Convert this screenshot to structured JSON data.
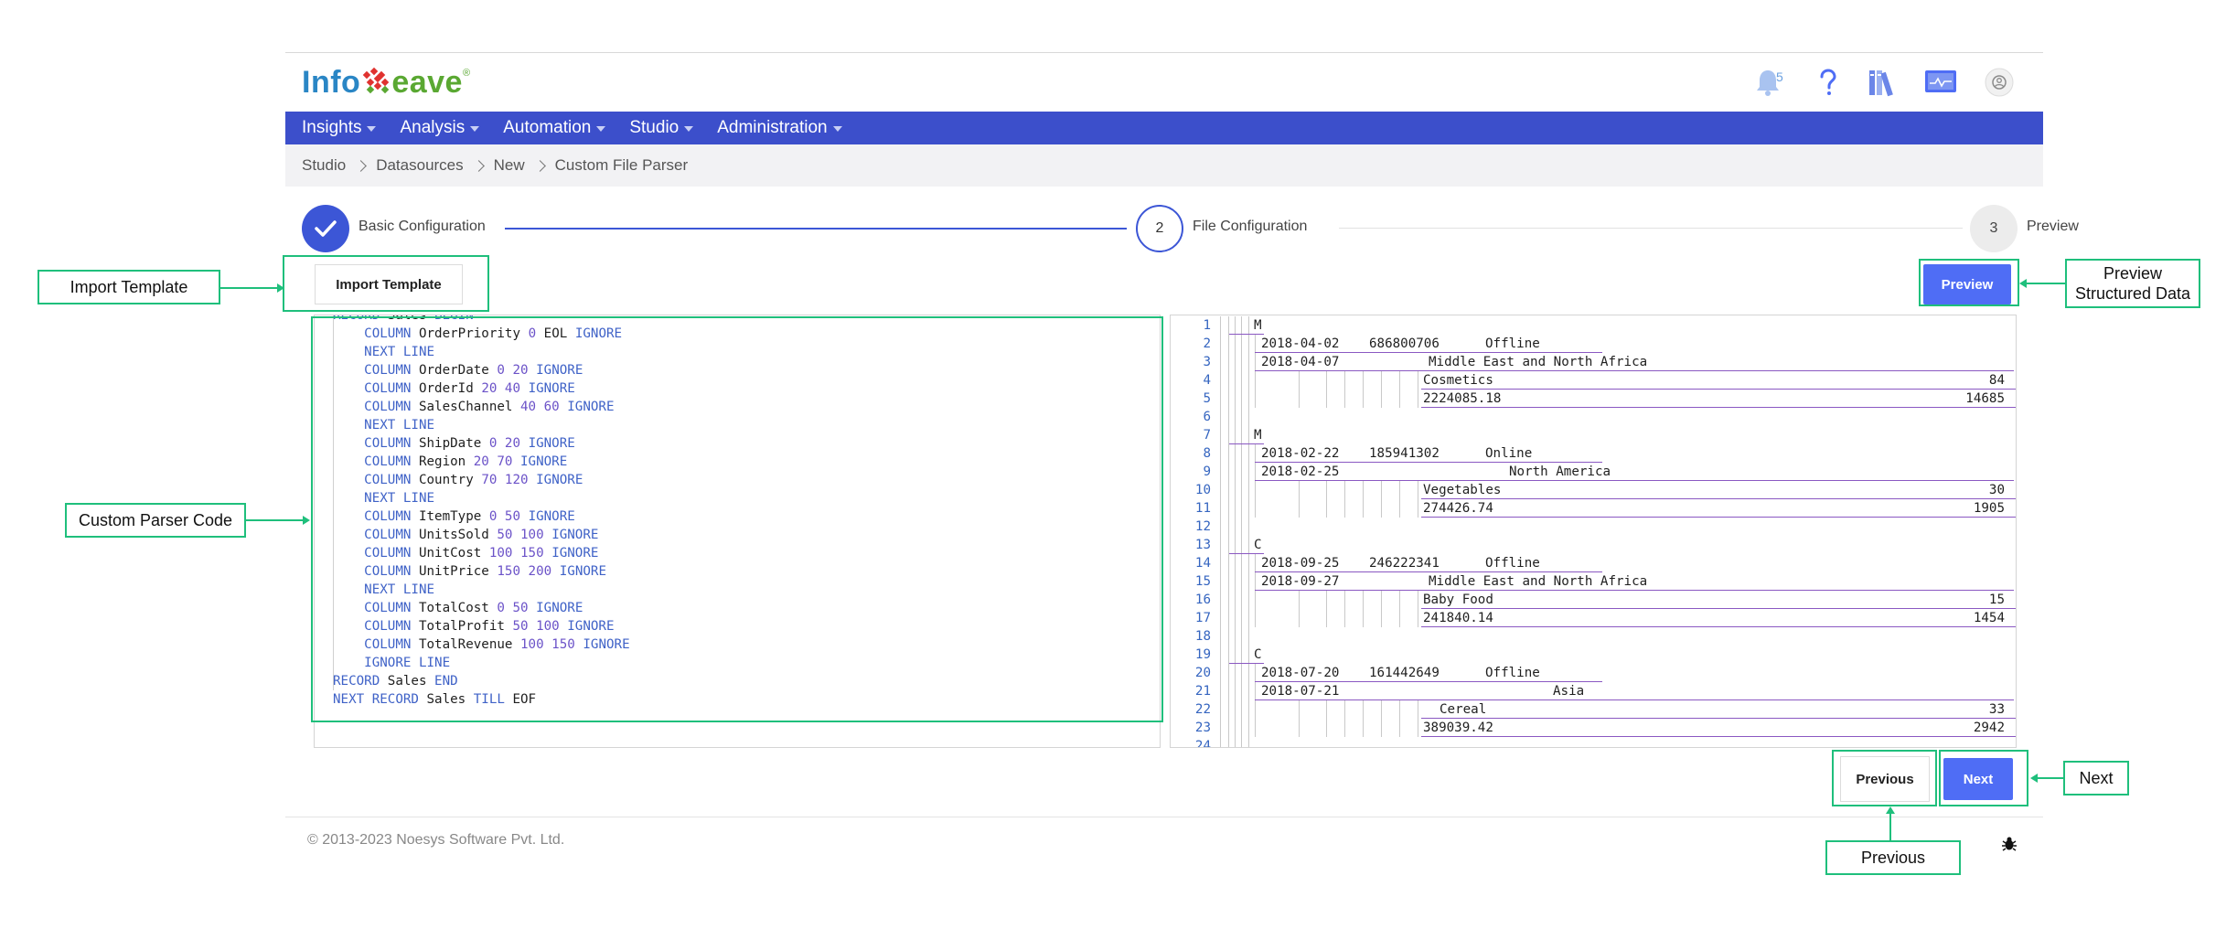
{
  "brand": {
    "logo_left": "Info",
    "logo_right": "eave",
    "logo_mark": "W"
  },
  "header": {
    "notifications_count": "5"
  },
  "nav": [
    "Insights",
    "Analysis",
    "Automation",
    "Studio",
    "Administration"
  ],
  "breadcrumb": [
    "Studio",
    "Datasources",
    "New",
    "Custom File Parser"
  ],
  "steps": [
    {
      "number": "",
      "label": "Basic Configuration",
      "state": "done"
    },
    {
      "number": "2",
      "label": "File Configuration",
      "state": "active"
    },
    {
      "number": "3",
      "label": "Preview",
      "state": "pending"
    }
  ],
  "buttons": {
    "import_template": "Import Template",
    "preview": "Preview",
    "previous": "Previous",
    "next": "Next"
  },
  "editor": {
    "lines": [
      [
        [
          "kw",
          "RECORD "
        ],
        [
          "ident",
          "Sales "
        ],
        [
          "kw",
          "BEGIN"
        ]
      ],
      [
        [
          "kw",
          "    COLUMN "
        ],
        [
          "ident",
          "OrderPriority "
        ],
        [
          "num",
          "0 "
        ],
        [
          "ident",
          "EOL "
        ],
        [
          "kw",
          "IGNORE"
        ]
      ],
      [
        [
          "kw",
          "    NEXT LINE"
        ]
      ],
      [
        [
          "kw",
          "    COLUMN "
        ],
        [
          "ident",
          "OrderDate "
        ],
        [
          "num",
          "0 20 "
        ],
        [
          "kw",
          "IGNORE"
        ]
      ],
      [
        [
          "kw",
          "    COLUMN "
        ],
        [
          "ident",
          "OrderId "
        ],
        [
          "num",
          "20 40 "
        ],
        [
          "kw",
          "IGNORE"
        ]
      ],
      [
        [
          "kw",
          "    COLUMN "
        ],
        [
          "ident",
          "SalesChannel "
        ],
        [
          "num",
          "40 60 "
        ],
        [
          "kw",
          "IGNORE"
        ]
      ],
      [
        [
          "kw",
          "    NEXT LINE"
        ]
      ],
      [
        [
          "kw",
          "    COLUMN "
        ],
        [
          "ident",
          "ShipDate "
        ],
        [
          "num",
          "0 20 "
        ],
        [
          "kw",
          "IGNORE"
        ]
      ],
      [
        [
          "kw",
          "    COLUMN "
        ],
        [
          "ident",
          "Region "
        ],
        [
          "num",
          "20 70 "
        ],
        [
          "kw",
          "IGNORE"
        ]
      ],
      [
        [
          "kw",
          "    COLUMN "
        ],
        [
          "ident",
          "Country "
        ],
        [
          "num",
          "70 120 "
        ],
        [
          "kw",
          "IGNORE"
        ]
      ],
      [
        [
          "kw",
          "    NEXT LINE"
        ]
      ],
      [
        [
          "kw",
          "    COLUMN "
        ],
        [
          "ident",
          "ItemType "
        ],
        [
          "num",
          "0 50 "
        ],
        [
          "kw",
          "IGNORE"
        ]
      ],
      [
        [
          "kw",
          "    COLUMN "
        ],
        [
          "ident",
          "UnitsSold "
        ],
        [
          "num",
          "50 100 "
        ],
        [
          "kw",
          "IGNORE"
        ]
      ],
      [
        [
          "kw",
          "    COLUMN "
        ],
        [
          "ident",
          "UnitCost "
        ],
        [
          "num",
          "100 150 "
        ],
        [
          "kw",
          "IGNORE"
        ]
      ],
      [
        [
          "kw",
          "    COLUMN "
        ],
        [
          "ident",
          "UnitPrice "
        ],
        [
          "num",
          "150 200 "
        ],
        [
          "kw",
          "IGNORE"
        ]
      ],
      [
        [
          "kw",
          "    NEXT LINE"
        ]
      ],
      [
        [
          "kw",
          "    COLUMN "
        ],
        [
          "ident",
          "TotalCost "
        ],
        [
          "num",
          "0 50 "
        ],
        [
          "kw",
          "IGNORE"
        ]
      ],
      [
        [
          "kw",
          "    COLUMN "
        ],
        [
          "ident",
          "TotalProfit "
        ],
        [
          "num",
          "50 100 "
        ],
        [
          "kw",
          "IGNORE"
        ]
      ],
      [
        [
          "kw",
          "    COLUMN "
        ],
        [
          "ident",
          "TotalRevenue "
        ],
        [
          "num",
          "100 150 "
        ],
        [
          "kw",
          "IGNORE"
        ]
      ],
      [
        [
          "kw",
          "    IGNORE LINE"
        ]
      ],
      [
        [
          "kw",
          "RECORD "
        ],
        [
          "ident",
          "Sales "
        ],
        [
          "kw",
          "END"
        ]
      ],
      [
        [
          "kw",
          "NEXT RECORD "
        ],
        [
          "ident",
          "Sales "
        ],
        [
          "kw",
          "TILL "
        ],
        [
          "ident",
          "EOF"
        ]
      ]
    ]
  },
  "preview_rows": [
    {
      "ln": "1",
      "cells": [
        "M"
      ]
    },
    {
      "ln": "2",
      "cells": [
        "2018-04-02",
        "686800706",
        "Offline"
      ]
    },
    {
      "ln": "3",
      "cells": [
        "2018-04-07",
        "Middle East and North Africa"
      ]
    },
    {
      "ln": "4",
      "cells": [
        "Cosmetics",
        "84"
      ]
    },
    {
      "ln": "5",
      "cells": [
        "2224085.18",
        "14685"
      ]
    },
    {
      "ln": "6",
      "cells": []
    },
    {
      "ln": "7",
      "cells": [
        "M"
      ]
    },
    {
      "ln": "8",
      "cells": [
        "2018-02-22",
        "185941302",
        "Online"
      ]
    },
    {
      "ln": "9",
      "cells": [
        "2018-02-25",
        "North America"
      ]
    },
    {
      "ln": "10",
      "cells": [
        "Vegetables",
        "30"
      ]
    },
    {
      "ln": "11",
      "cells": [
        "274426.74",
        "1905"
      ]
    },
    {
      "ln": "12",
      "cells": []
    },
    {
      "ln": "13",
      "cells": [
        "C"
      ]
    },
    {
      "ln": "14",
      "cells": [
        "2018-09-25",
        "246222341",
        "Offline"
      ]
    },
    {
      "ln": "15",
      "cells": [
        "2018-09-27",
        "Middle East and North Africa"
      ]
    },
    {
      "ln": "16",
      "cells": [
        "Baby Food",
        "15"
      ]
    },
    {
      "ln": "17",
      "cells": [
        "241840.14",
        "1454"
      ]
    },
    {
      "ln": "18",
      "cells": []
    },
    {
      "ln": "19",
      "cells": [
        "C"
      ]
    },
    {
      "ln": "20",
      "cells": [
        "2018-07-20",
        "161442649",
        "Offline"
      ]
    },
    {
      "ln": "21",
      "cells": [
        "2018-07-21",
        "Asia"
      ]
    },
    {
      "ln": "22",
      "cells": [
        "Cereal",
        "33"
      ]
    },
    {
      "ln": "23",
      "cells": [
        "389039.42",
        "2942"
      ]
    },
    {
      "ln": "24",
      "cells": []
    }
  ],
  "footer": {
    "copyright": "© 2013-2023 Noesys Software Pvt. Ltd."
  },
  "annotations": {
    "import_template": "Import Template",
    "custom_parser_code": "Custom Parser Code",
    "preview_structured_data": "Preview Structured Data",
    "next": "Next",
    "previous": "Previous"
  },
  "colors": {
    "nav": "#3c4fcb",
    "accent": "#4f6df5",
    "annotation": "#1fbf7c"
  }
}
